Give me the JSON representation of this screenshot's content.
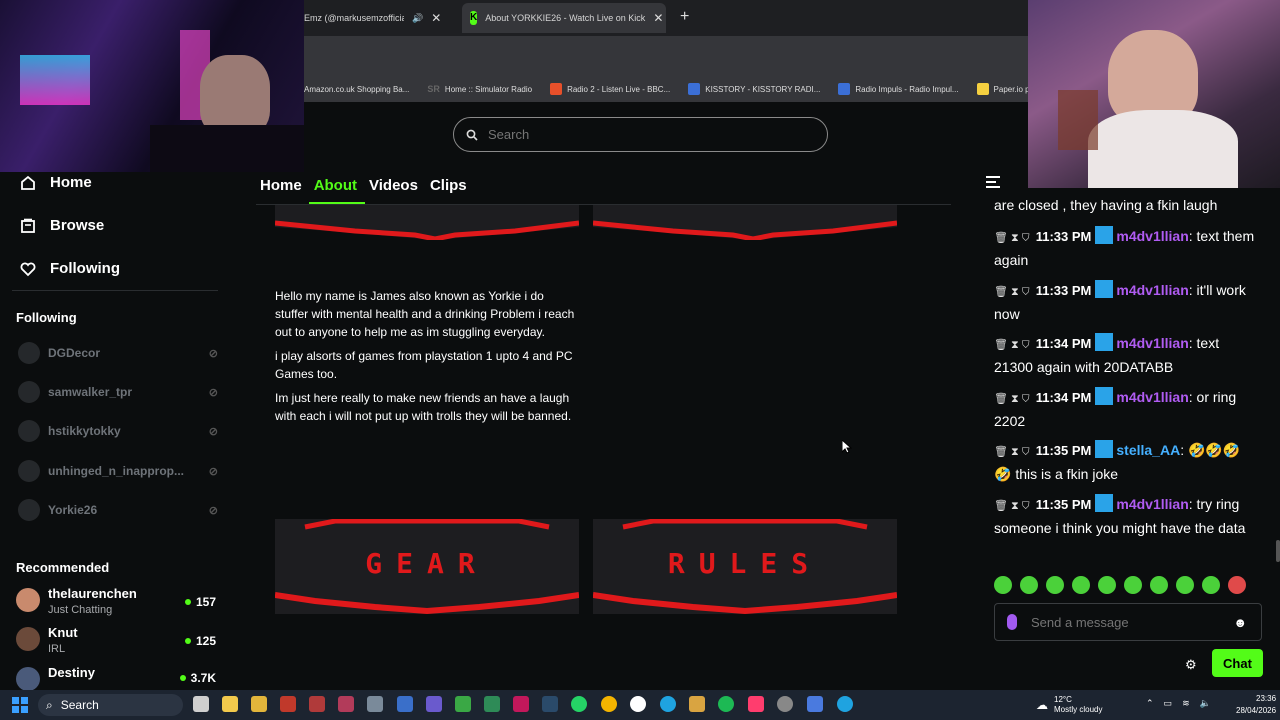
{
  "browser": {
    "tabs": [
      {
        "title": "Emz (@markusemzofficial) is",
        "active": false
      },
      {
        "title": "About YORKKIE26 - Watch Live on Kick",
        "active": true
      }
    ],
    "bookmarks": [
      {
        "label": "Amazon.co.uk Shopping Ba...",
        "color": "#f90"
      },
      {
        "label": "Home :: Simulator Radio",
        "prefix": "SR"
      },
      {
        "label": "Radio 2 - Listen Live - BBC...",
        "color": "#e8502a"
      },
      {
        "label": "KISSTORY - KISSTORY RADI...",
        "color": "#3b6fd6"
      },
      {
        "label": "Radio Impuls - Radio Impul...",
        "color": "#3b6fd6"
      },
      {
        "label": "Paper.io play o",
        "color": "#f5d040"
      }
    ]
  },
  "search": {
    "placeholder": "Search"
  },
  "sidebar": {
    "nav": [
      {
        "label": "Home",
        "icon": "home-icon"
      },
      {
        "label": "Browse",
        "icon": "browse-icon"
      },
      {
        "label": "Following",
        "icon": "heart-icon"
      }
    ],
    "following_title": "Following",
    "following": [
      {
        "name": "DGDecor"
      },
      {
        "name": "samwalker_tpr"
      },
      {
        "name": "hstikkytokky"
      },
      {
        "name": "unhinged_n_inapprop..."
      },
      {
        "name": "Yorkie26"
      }
    ],
    "recommended_title": "Recommended",
    "recommended": [
      {
        "name": "thelaurenchen",
        "category": "Just Chatting",
        "viewers": "157",
        "avatar_color": "#c98a6d"
      },
      {
        "name": "Knut",
        "category": "IRL",
        "viewers": "125",
        "avatar_color": "#6b4a3a"
      },
      {
        "name": "Destiny",
        "category": "",
        "viewers": "3.7K",
        "avatar_color": "#4a5a7a"
      }
    ]
  },
  "page_tabs": [
    {
      "label": "Home",
      "active": false
    },
    {
      "label": "About",
      "active": true
    },
    {
      "label": "Videos",
      "active": false
    },
    {
      "label": "Clips",
      "active": false
    }
  ],
  "about": {
    "paragraphs": [
      "Hello my name is James also known as Yorkie i do stuffer with mental health and a drinking Problem i reach out to anyone to help me as im stuggling everyday.",
      "i play alsorts of games from playstation 1 upto 4 and PC Games too.",
      "Im just here really to make new friends an have a laugh with each i will not put up with trolls they will be banned."
    ]
  },
  "panels": {
    "gear": "GEAR",
    "rules": "RULES"
  },
  "chat": {
    "partial_top": "are closed , they having a fkin laugh",
    "messages": [
      {
        "time": "11:33 PM",
        "user": "m4dv1llian",
        "text": ": text them again",
        "user_color": "purple"
      },
      {
        "time": "11:33 PM",
        "user": "m4dv1llian",
        "text": ": it'll work now",
        "user_color": "purple"
      },
      {
        "time": "11:34 PM",
        "user": "m4dv1llian",
        "text": ": text 21300 again with 20DATABB",
        "user_color": "purple"
      },
      {
        "time": "11:34 PM",
        "user": "m4dv1llian",
        "text": ": or ring 2202",
        "user_color": "purple"
      },
      {
        "time": "11:35 PM",
        "user": "stella_AA",
        "text": ": 🤣🤣🤣🤣 this is a fkin joke",
        "user_color": "blue"
      },
      {
        "time": "11:35 PM",
        "user": "m4dv1llian",
        "text": ": try ring someone i think you might have the data",
        "user_color": "purple"
      }
    ],
    "input_placeholder": "Send a message",
    "send_label": "Chat"
  },
  "taskbar": {
    "search_label": "Search",
    "weather_temp": "12°C",
    "weather_desc": "Mostly cloudy",
    "time": "23:36",
    "date": "28/04/2026"
  },
  "colors": {
    "accent": "#53fc18",
    "panel_red": "#e0191b",
    "chat_purple": "#b05cf2",
    "chat_blue": "#45b0ff"
  }
}
